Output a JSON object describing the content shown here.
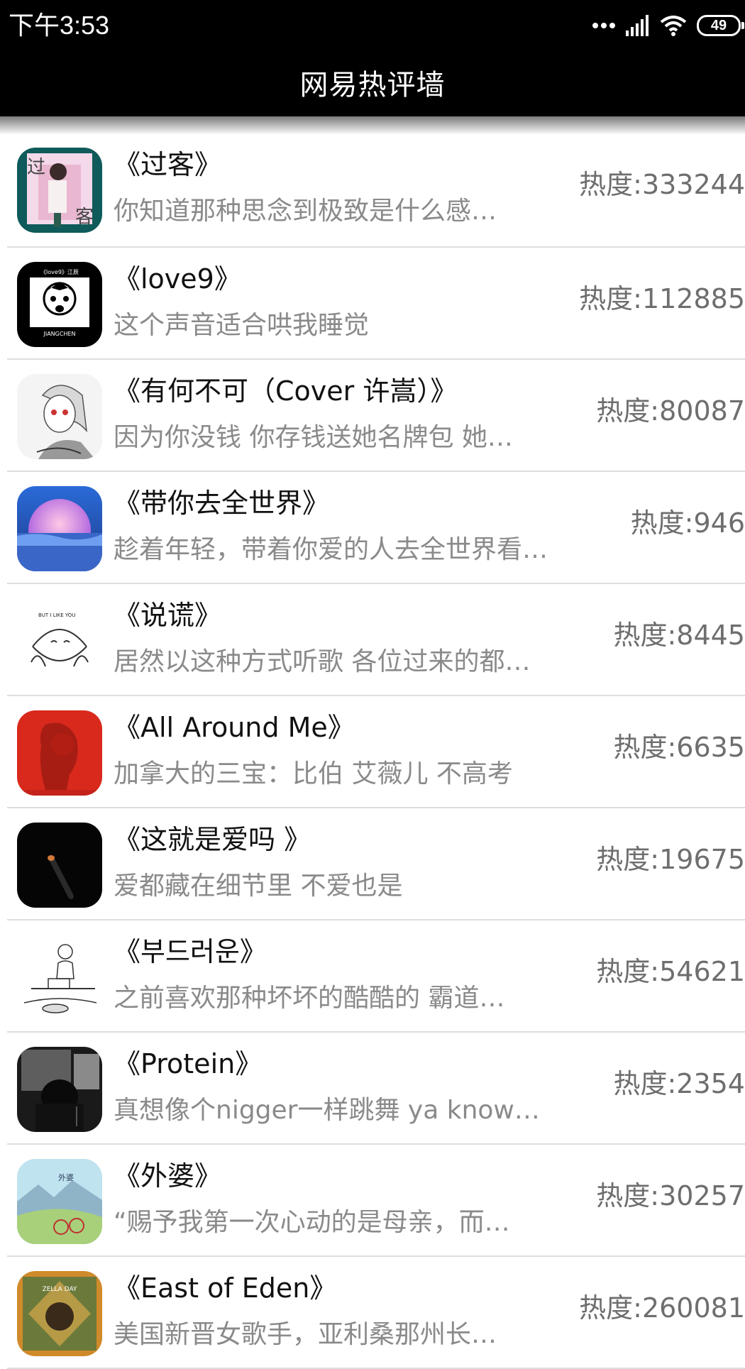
{
  "status": {
    "time": "下午3:53",
    "battery": "49"
  },
  "header": {
    "title": "网易热评墙"
  },
  "heat_label": "热度:",
  "items": [
    {
      "song": "《过客》",
      "comment": "你知道那种思念到极致是什么感…",
      "heat": "333244",
      "cover_text": "过",
      "cover_text2": "客"
    },
    {
      "song": "《love9》",
      "comment": "这个声音适合哄我睡觉",
      "heat": "112885",
      "cover_text": "《love9》江辰",
      "cover_text2": "JIANGCHEN"
    },
    {
      "song": "《有何不可（Cover 许嵩）》",
      "comment": "因为你没钱 你存钱送她名牌包 她…",
      "heat": "80087"
    },
    {
      "song": "《带你去全世界》",
      "comment": "趁着年轻，带着你爱的人去全世界看…",
      "heat": "946"
    },
    {
      "song": "《说谎》",
      "comment": "居然以这种方式听歌 各位过来的都…",
      "heat": "8445",
      "cover_text": "BUT I LIKE YOU"
    },
    {
      "song": "《All Around Me》",
      "comment": "加拿大的三宝：比伯 艾薇儿 不高考",
      "heat": "6635"
    },
    {
      "song": "《这就是爱吗 》",
      "comment": "爱都藏在细节里 不爱也是",
      "heat": "19675"
    },
    {
      "song": "《부드러운》",
      "comment": "之前喜欢那种坏坏的酷酷的 霸道…",
      "heat": "54621"
    },
    {
      "song": "《Protein》",
      "comment": "真想像个nigger一样跳舞 ya know…",
      "heat": "2354"
    },
    {
      "song": "《外婆》",
      "comment": "“赐予我第一次心动的是母亲，而…",
      "heat": "30257",
      "cover_text": "外婆"
    },
    {
      "song": "《East of Eden》",
      "comment": "美国新晋女歌手，亚利桑那州长…",
      "heat": "260081",
      "cover_text": "ZELLA DAY"
    }
  ]
}
